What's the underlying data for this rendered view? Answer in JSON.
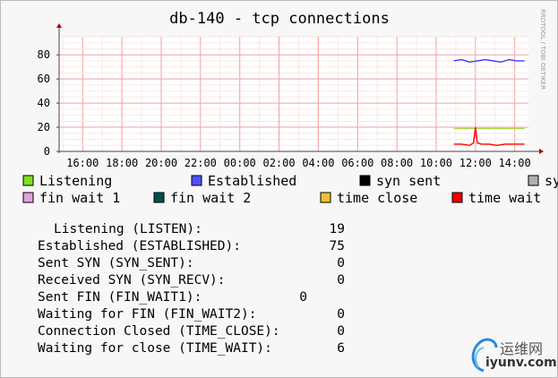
{
  "chart_data": {
    "type": "line",
    "title": "db-140 - tcp connections",
    "watermark": "RRDTOOL / TOBI OETIKER",
    "ylim": [
      0,
      95
    ],
    "y_ticks": [
      0,
      20,
      40,
      60,
      80
    ],
    "x_tick_labels": [
      "16:00",
      "18:00",
      "20:00",
      "22:00",
      "00:00",
      "02:00",
      "04:00",
      "06:00",
      "08:00",
      "10:00",
      "12:00",
      "14:00"
    ],
    "x_range_hours": [
      14.8,
      38.7
    ],
    "series": [
      {
        "name": "Established",
        "color": "#3b3bff",
        "x": [
          34.9,
          35.3,
          35.7,
          36.1,
          36.5,
          36.9,
          37.3,
          37.7,
          38.1,
          38.5
        ],
        "values": [
          75,
          76,
          74,
          75,
          76,
          75,
          74,
          76,
          75,
          75
        ]
      },
      {
        "name": "Listening",
        "color": "#a8d840",
        "x": [
          34.9,
          35.5,
          36.1,
          36.7,
          37.3,
          37.9,
          38.5
        ],
        "values": [
          19,
          19,
          19,
          19,
          19,
          19,
          19
        ]
      },
      {
        "name": "time wait",
        "color": "#ff0000",
        "x": [
          34.9,
          35.3,
          35.7,
          35.9,
          36.0,
          36.1,
          36.3,
          36.7,
          37.1,
          37.5,
          37.9,
          38.3,
          38.5
        ],
        "values": [
          6,
          6,
          5,
          7,
          20,
          7,
          6,
          6,
          5,
          6,
          6,
          6,
          6
        ]
      }
    ]
  },
  "legend": [
    {
      "label": "Listening",
      "color": "#80e020"
    },
    {
      "label": "Established",
      "color": "#4f4fff"
    },
    {
      "label": "syn sent",
      "color": "#000000"
    },
    {
      "label": "sy",
      "color": "#b0b0b0"
    },
    {
      "label": "fin wait 1",
      "color": "#e0a0e0"
    },
    {
      "label": "fin wait 2",
      "color": "#005050"
    },
    {
      "label": "time close",
      "color": "#f0c030"
    },
    {
      "label": "time wait",
      "color": "#ee0000"
    }
  ],
  "stats": [
    {
      "label": "Listening (LISTEN):",
      "value": "19"
    },
    {
      "label": "Established (ESTABLISHED):",
      "value": "75"
    },
    {
      "label": "Sent SYN (SYN_SENT):",
      "value": "0"
    },
    {
      "label": "Received SYN (SYN_RECV):",
      "value": "0"
    },
    {
      "label": "Sent FIN (FIN_WAIT1):",
      "value": "0"
    },
    {
      "label": "Waiting for FIN (FIN_WAIT2):",
      "value": "0"
    },
    {
      "label": "Connection Closed (TIME_CLOSE):",
      "value": "0"
    },
    {
      "label": "Waiting for close (TIME_WAIT):",
      "value": "6"
    }
  ],
  "logo": {
    "cn": "运维网",
    "en": "iyunv.com"
  }
}
